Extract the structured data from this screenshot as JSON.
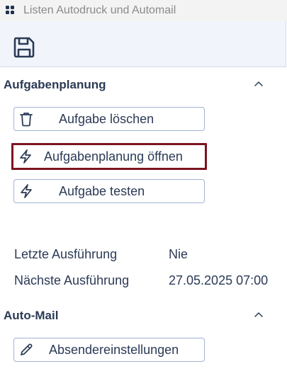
{
  "window": {
    "title": "Listen Autodruck und Automail"
  },
  "toolbar": {
    "save_icon": "save-icon"
  },
  "sections": {
    "planning": {
      "title": "Aufgabenplanung",
      "delete_label": "Aufgabe löschen",
      "open_label": "Aufgabenplanung öffnen",
      "test_label": "Aufgabe testen"
    },
    "execution": {
      "last_label": "Letzte Ausführung",
      "last_value": "Nie",
      "next_label": "Nächste Ausführung",
      "next_value": "27.05.2025 07:00"
    },
    "automail": {
      "title": "Auto-Mail",
      "sender_label": "Absendereinstellungen"
    }
  },
  "colors": {
    "text": "#2b3a55",
    "button_border": "#9fb4d6",
    "focus_border": "#7b1420",
    "toolbar_bg": "#f1f4fb",
    "titlebar_bg": "#f3f3f3"
  }
}
